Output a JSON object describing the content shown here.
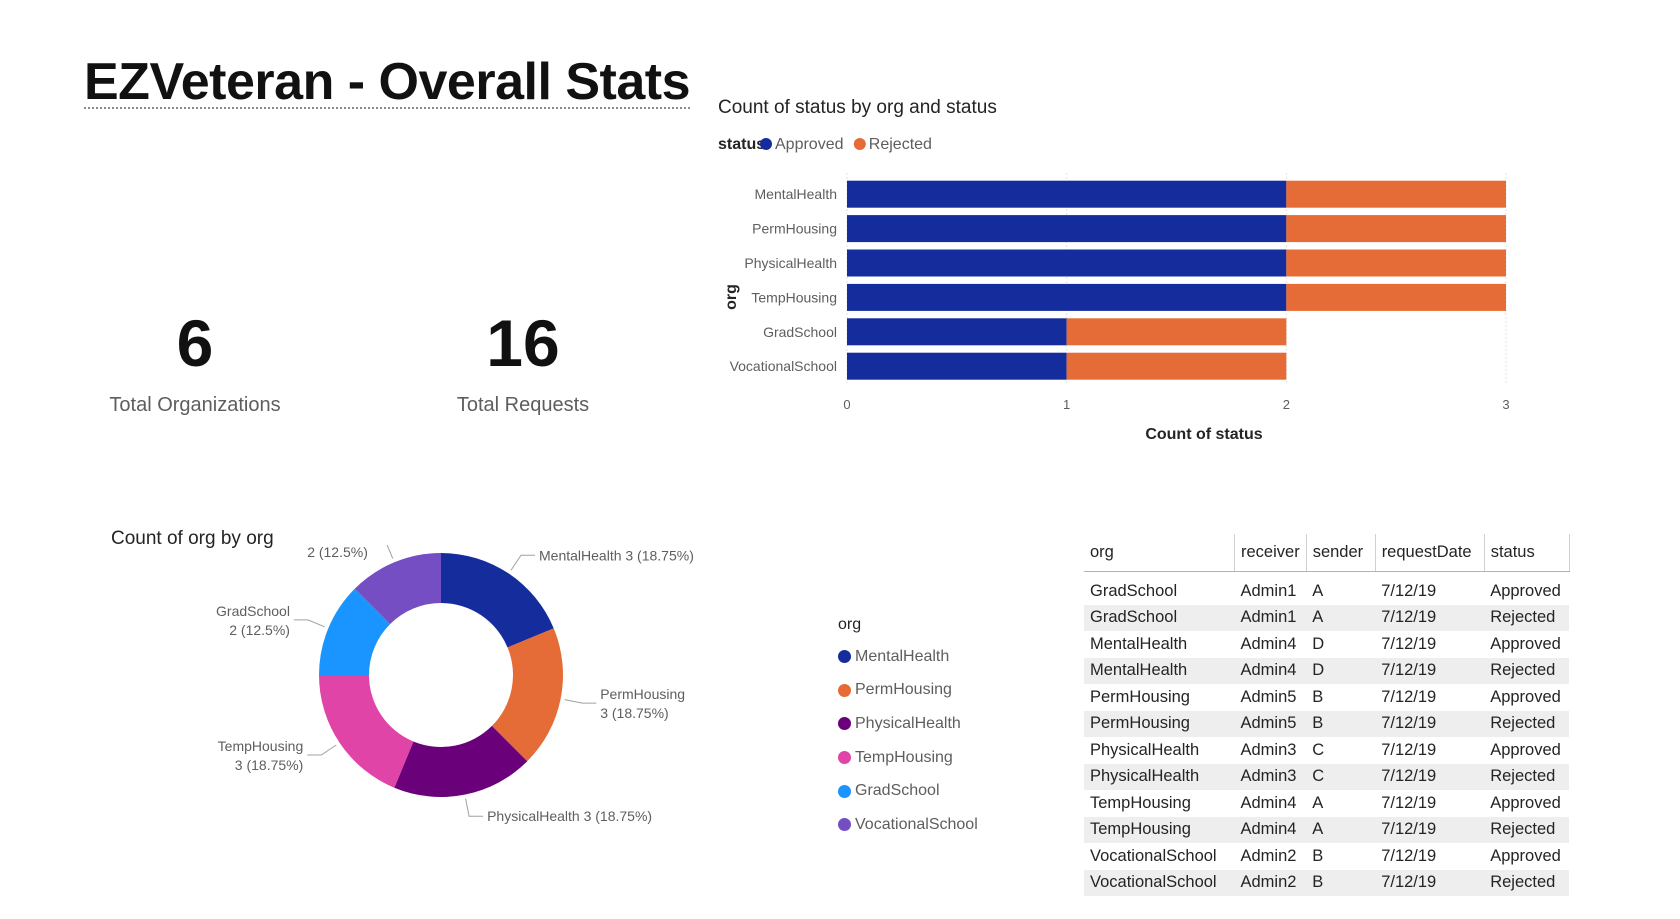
{
  "page": {
    "title": "EZVeteran - Overall Stats"
  },
  "cards": [
    {
      "value": "6",
      "label": "Total Organizations"
    },
    {
      "value": "16",
      "label": "Total Requests"
    }
  ],
  "colors": {
    "approved": "#152C9C",
    "rejected": "#E66C37",
    "MentalHealth": "#152C9C",
    "PermHousing": "#E66C37",
    "PhysicalHealth": "#6B007B",
    "TempHousing": "#E044A7",
    "GradSchool": "#1A94FF",
    "VocationalSchool": "#744EC2"
  },
  "chart_data": [
    {
      "type": "bar",
      "orientation": "horizontal",
      "stacked": true,
      "title": "Count of status by org and status",
      "legend_title": "status",
      "legend_position": "top-left",
      "categories": [
        "MentalHealth",
        "PermHousing",
        "PhysicalHealth",
        "TempHousing",
        "GradSchool",
        "VocationalSchool"
      ],
      "series": [
        {
          "name": "Approved",
          "values": [
            2,
            2,
            2,
            2,
            1,
            1
          ]
        },
        {
          "name": "Rejected",
          "values": [
            1,
            1,
            1,
            1,
            1,
            1
          ]
        }
      ],
      "xlabel": "Count of status",
      "ylabel": "org",
      "xlim": [
        0,
        3
      ],
      "xticks": [
        "0",
        "1",
        "2",
        "3"
      ],
      "grid": true
    },
    {
      "type": "pie",
      "donut": true,
      "title": "Count of org by org",
      "legend_title": "org",
      "legend_position": "right",
      "labels": [
        "MentalHealth",
        "PermHousing",
        "PhysicalHealth",
        "TempHousing",
        "GradSchool",
        "VocationalSchool"
      ],
      "values": [
        3,
        3,
        3,
        3,
        2,
        2
      ],
      "data_labels": [
        [
          "MentalHealth 3 (18.75%)"
        ],
        [
          "PermHousing",
          "3 (18.75%)"
        ],
        [
          "PhysicalHealth 3 (18.75%)"
        ],
        [
          "TempHousing",
          "3 (18.75%)"
        ],
        [
          "GradSchool",
          "2 (12.5%)"
        ],
        [
          "VocationalSchool",
          "2 (12.5%)"
        ]
      ]
    },
    {
      "type": "table",
      "columns": [
        "org",
        "receiver",
        "sender",
        "requestDate",
        "status"
      ],
      "rows": [
        [
          "GradSchool",
          "Admin1",
          "A",
          "7/12/19",
          "Approved"
        ],
        [
          "GradSchool",
          "Admin1",
          "A",
          "7/12/19",
          "Rejected"
        ],
        [
          "MentalHealth",
          "Admin4",
          "D",
          "7/12/19",
          "Approved"
        ],
        [
          "MentalHealth",
          "Admin4",
          "D",
          "7/12/19",
          "Rejected"
        ],
        [
          "PermHousing",
          "Admin5",
          "B",
          "7/12/19",
          "Approved"
        ],
        [
          "PermHousing",
          "Admin5",
          "B",
          "7/12/19",
          "Rejected"
        ],
        [
          "PhysicalHealth",
          "Admin3",
          "C",
          "7/12/19",
          "Approved"
        ],
        [
          "PhysicalHealth",
          "Admin3",
          "C",
          "7/12/19",
          "Rejected"
        ],
        [
          "TempHousing",
          "Admin4",
          "A",
          "7/12/19",
          "Approved"
        ],
        [
          "TempHousing",
          "Admin4",
          "A",
          "7/12/19",
          "Rejected"
        ],
        [
          "VocationalSchool",
          "Admin2",
          "B",
          "7/12/19",
          "Approved"
        ],
        [
          "VocationalSchool",
          "Admin2",
          "B",
          "7/12/19",
          "Rejected"
        ]
      ]
    }
  ]
}
